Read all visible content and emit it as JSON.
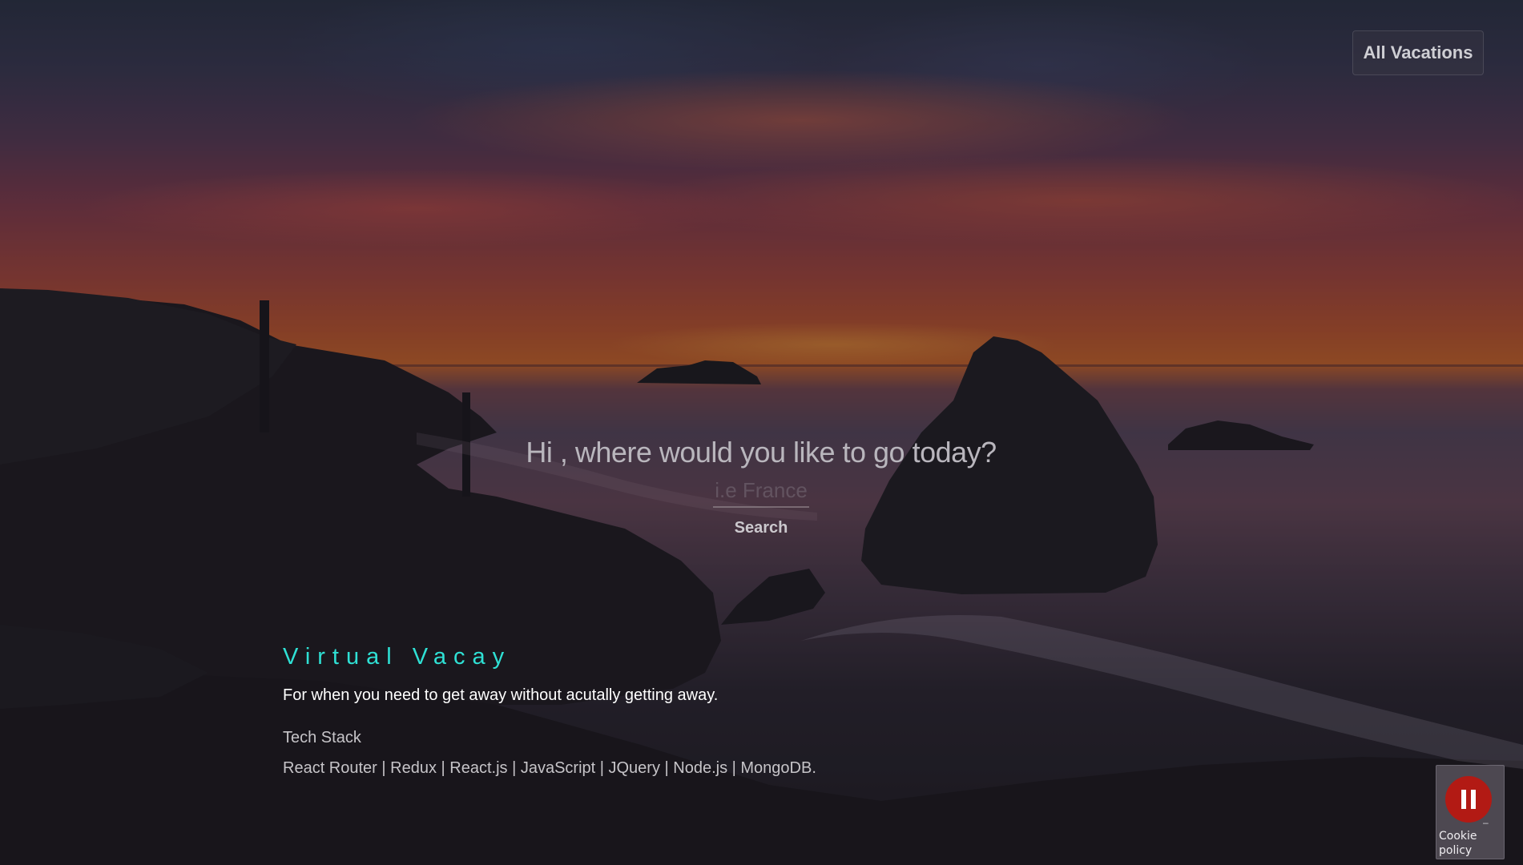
{
  "header": {
    "all_vacations_label": "All Vacations"
  },
  "search": {
    "prompt": "Hi , where would you like to go today?",
    "placeholder": "i.e France",
    "value": "",
    "button_label": "Search"
  },
  "brand": {
    "name": "Virtual Vacay",
    "tagline": "For when you need to get away without acutally getting away."
  },
  "tech_stack": {
    "heading": "Tech Stack",
    "items": "React Router | Redux | React.js | JavaScript | JQuery | Node.js | MongoDB."
  },
  "cookie_widget": {
    "label": "Cookie policy",
    "pause_icon": "pause-icon",
    "minimize_glyph": "–"
  },
  "colors": {
    "brand_accent": "#2fe0d4",
    "pause_button": "#b21a14"
  },
  "background": {
    "description_icon": "sunset-sea-rocks-photo"
  }
}
